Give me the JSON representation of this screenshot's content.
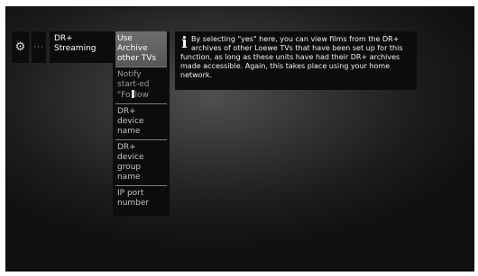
{
  "toolbar": {
    "settings_icon": "gear-icon",
    "more_label": "···"
  },
  "menu": {
    "panel_label": "DR+ Streaming",
    "items": [
      {
        "label": "Use Archive other TVs",
        "state": "selected"
      },
      {
        "label_before_cursor": "Notify start-ed \"Fo",
        "label_after_cursor": "low",
        "state": "dimmed"
      },
      {
        "label": "DR+ device name"
      },
      {
        "label": "DR+ device group name"
      },
      {
        "label": "IP port number"
      }
    ]
  },
  "info": {
    "icon": "info-icon",
    "text": "By selecting \"yes\" here, you can view films from the DR+ archives of other Loewe TVs that have been set up for this function, as long as these units have had their DR+ archives made accessible. Again, this takes place using your home network."
  }
}
